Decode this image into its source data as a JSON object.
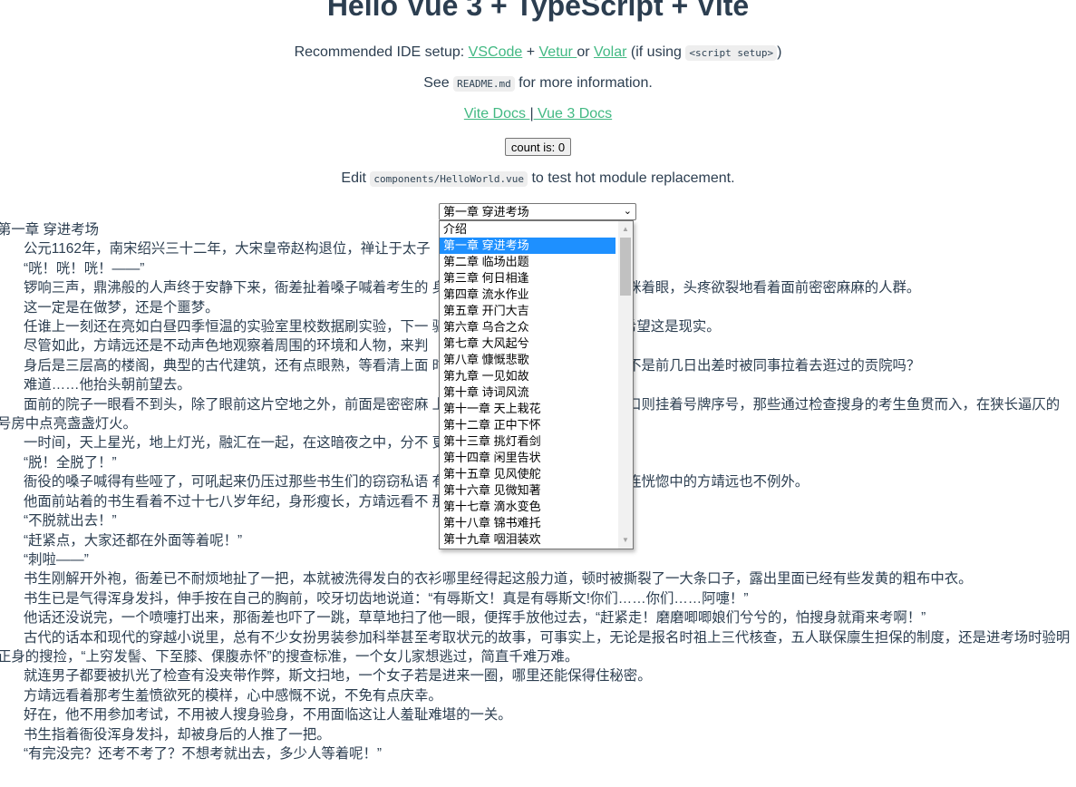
{
  "header": {
    "title": "Hello Vue 3 + TypeScript + Vite",
    "ide_prefix": "Recommended IDE setup: ",
    "vscode": "VSCode",
    "plus": " + ",
    "vetur": "Vetur ",
    "or": "or ",
    "volar": "Volar",
    "if_using": " (if using ",
    "script_setup": "<script setup>",
    "close_paren": ")",
    "see": "See ",
    "readme": "README.md",
    "more_info": " for more information.",
    "vite_docs": "Vite Docs ",
    "sep": "|",
    "vue_docs": " Vue 3 Docs",
    "count_button": "count is: 0",
    "edit": "Edit ",
    "component_path": "components/HelloWorld.vue",
    "hmr": " to test hot module replacement."
  },
  "chapter_select": {
    "selected": "第一章 穿进考场",
    "options": [
      "介绍",
      "第一章 穿进考场",
      "第二章 临场出题",
      "第三章 何日相逢",
      "第四章 流水作业",
      "第五章 开门大吉",
      "第六章 乌合之众",
      "第七章 大风起兮",
      "第八章 慷慨悲歌",
      "第九章 一见如故",
      "第十章 诗词风流",
      "第十一章 天上栽花",
      "第十二章 正中下怀",
      "第十三章 挑灯看剑",
      "第十四章 闲里告状",
      "第十五章 见风使舵",
      "第十六章 见微知著",
      "第十七章 滴水变色",
      "第十八章 锦书难托",
      "第十九章 咽泪装欢"
    ]
  },
  "chapter": {
    "title": "第一章 穿进考场",
    "paragraphs": [
      "公元1162年，南宋绍兴三十二年，大宋皇帝赵构退位，禅让于太子",
      "“咣！咣！咣！——”",
      "锣响三声，鼎沸般的人声终于安静下来，衙差扯着嗓子喊着考生的 身入号，方靖远兀自揉着额角，眯着眼，头疼欲裂地看着面前密密麻麻的人群。",
      "这一定是在做梦，还是个噩梦。",
      "任谁上一刻还在亮如白昼四季恒温的实验室里校数据刷实验，下一 驱寒全靠抖的“大院”里，都不会希望这是现实。",
      "尽管如此，方靖远还是不动声色地观察着周围的环境和人物，来判",
      "身后是三层高的楼阁，典型的古代建筑，还有点眼熟，等看清上面 时，方靖远心里咯噔一下，这，不是前几日出差时被同事拉着去逛过的贡院吗？",
      "难道……他抬头朝前望去。",
      "面前的院子一眼看不到头，除了眼前这片空地之外，前面是密密麻 上写着天干字号，里面的号房门口则挂着号牌序号，那些通过检查搜身的考生鱼贯而入，在狭长逼仄的号房中点亮盏盏灯火。",
      "一时间，天上星光，地上灯光，融汇在一起，在这暗夜之中，分不 更分不清，此时此刻，是梦是真。",
      "“脱！全脱了！”",
      "衙役的嗓子喊得有些哑了，可吼起来仍压过那些书生们的窃窃私语 有人的视线都集中在了那一处，连恍惚中的方靖远也不例外。",
      "他面前站着的书生看着不过十七八岁年纪，身形瘦长，方靖远看不 那张脸上的屈辱和不甘。",
      "“不脱就出去！”",
      "“赶紧点，大家还都在外面等着呢！”",
      "“刺啦——”",
      "书生刚解开外袍，衙差已不耐烦地扯了一把，本就被洗得发白的衣衫哪里经得起这般力道，顿时被撕裂了一大条口子，露出里面已经有些发黄的粗布中衣。",
      "书生已是气得浑身发抖，伸手按在自己的胸前，咬牙切齿地说道：“有辱斯文！真是有辱斯文!你们……你们……阿嚏！”",
      "他话还没说完，一个喷嚏打出来，那衙差也吓了一跳，草草地扫了他一眼，便挥手放他过去，“赶紧走！磨磨唧唧娘们兮兮的，怕搜身就甭来考啊！”",
      "古代的话本和现代的穿越小说里，总有不少女扮男装参加科举甚至考取状元的故事，可事实上，无论是报名时祖上三代核查，五人联保廪生担保的制度，还是进考场时验明正身的搜捡，“上穷发髻、下至膝、倮腹赤怀”的搜查标准，一个女儿家想逃过，简直千难万难。",
      "就连男子都要被扒光了检查有没夹带作弊，斯文扫地，一个女子若是进来一圈，哪里还能保得住秘密。",
      "方靖远看着那考生羞愤欲死的模样，心中感慨不说，不免有点庆幸。",
      "好在，他不用参加考试，不用被人搜身验身，不用面临这让人羞耻难堪的一关。",
      "书生指着衙役浑身发抖，却被身后的人推了一把。",
      "“有完没完？还考不考了？不想考就出去，多少人等着呢！”"
    ]
  },
  "colors": {
    "text": "#2c3e50",
    "link": "#42b983",
    "selected_option": "#1e90ff"
  }
}
